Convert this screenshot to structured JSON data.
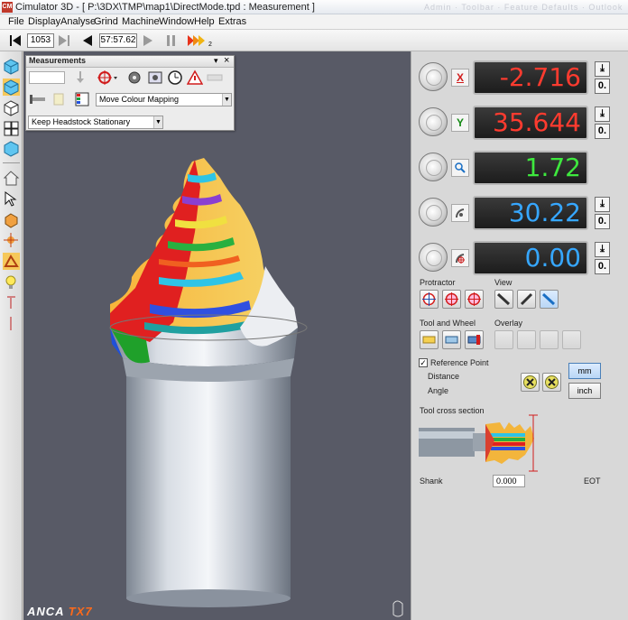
{
  "app": {
    "title": "Cimulator 3D - [ P:\\3DX\\TMP\\map1\\DirectMode.tpd : Measurement ]",
    "logo_text": "CM",
    "ghost_text": "Admin  ·  Toolbar  ·  Feature Defaults  ·  Outlook"
  },
  "menu": [
    "File",
    "Display",
    "Analyse",
    "Grind",
    "Machine",
    "Window",
    "Help",
    "Extras"
  ],
  "toolbar": {
    "frame_value": "1053",
    "time_value": "57:57.62",
    "speed_index": "2"
  },
  "measurements": {
    "title": "Measurements",
    "header_buttons": [
      "▾",
      "×"
    ],
    "colour_mode": "Move Colour Mapping",
    "headstock_mode": "Keep Headstock Stationary"
  },
  "axes": [
    {
      "label": "X",
      "value": "-2.716",
      "color": "#ff3b2f",
      "label_color": "#d11c1c",
      "has_buttons": true
    },
    {
      "label": "Y",
      "value": "35.644",
      "color": "#ff3b2f",
      "label_color": "#118811",
      "has_buttons": true
    },
    {
      "label": "zoom",
      "value": "1.72",
      "color": "#3ee83e",
      "label_color": "#1a6fc4",
      "has_buttons": false
    },
    {
      "label": "angle",
      "value": "30.22",
      "color": "#36a7ff",
      "label_color": "#555555",
      "has_buttons": true
    },
    {
      "label": "radius",
      "value": "0.00",
      "color": "#36a7ff",
      "label_color": "#cc2222",
      "has_buttons": true
    }
  ],
  "small_buttons": {
    "snap": "⤓",
    "zero": "0."
  },
  "groups": {
    "protractor": "Protractor",
    "view": "View",
    "tool_and_wheel": "Tool and Wheel",
    "overlay": "Overlay"
  },
  "reference": {
    "checkbox_label": "Reference Point",
    "checked": true,
    "distance_label": "Distance",
    "angle_label": "Angle",
    "mm_label": "mm",
    "inch_label": "inch",
    "active_unit": "mm"
  },
  "cross_section": {
    "title": "Tool cross section",
    "shank_label": "Shank",
    "shank_value": "0.000",
    "eot_label": "EOT"
  },
  "brand": {
    "anca": "ANCA",
    "tx": "TX7"
  },
  "colors": {
    "accent": "#4a7fb8",
    "viewport_bg": "#585a66",
    "display_bg": "#222222"
  }
}
